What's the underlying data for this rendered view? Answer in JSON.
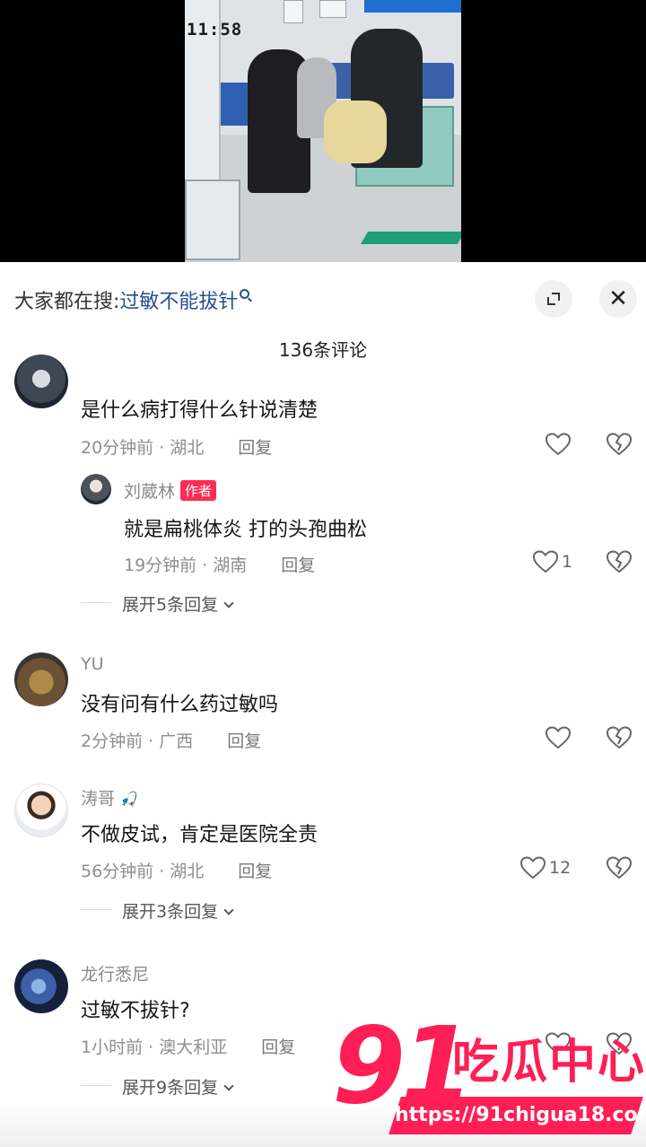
{
  "video": {
    "timestamp": "11:58"
  },
  "header": {
    "search_prefix": "大家都在搜:",
    "search_keyword": "过敏不能拔针",
    "comment_count": "136条评论"
  },
  "comments": [
    {
      "text": "是什么病打得什么针说清楚",
      "time": "20分钟前 · 湖北",
      "reply": "回复",
      "replies": [
        {
          "name": "刘葳林",
          "badge": "作者",
          "text": "就是扁桃体炎  打的头孢曲松",
          "time": "19分钟前 · 湖南",
          "reply": "回复",
          "likes": "1"
        }
      ],
      "more": "展开5条回复"
    },
    {
      "name": "YU",
      "text": "没有问有什么药过敏吗",
      "time": "2分钟前 · 广西",
      "reply": "回复"
    },
    {
      "name": "涛哥",
      "text": "不做皮试，肯定是医院全责",
      "time": "56分钟前 · 湖北",
      "reply": "回复",
      "likes": "12",
      "more": "展开3条回复"
    },
    {
      "name": "龙行悉尼",
      "text": "过敏不拔针?",
      "time": "1小时前 · 澳大利亚",
      "reply": "回复",
      "more": "展开9条回复"
    }
  ],
  "watermark": {
    "number": "91",
    "name": "吃瓜中心",
    "url": "https://91chigua18.com"
  },
  "colors": {
    "accent": "#fe2c55",
    "keyword": "#2a4e8f"
  }
}
